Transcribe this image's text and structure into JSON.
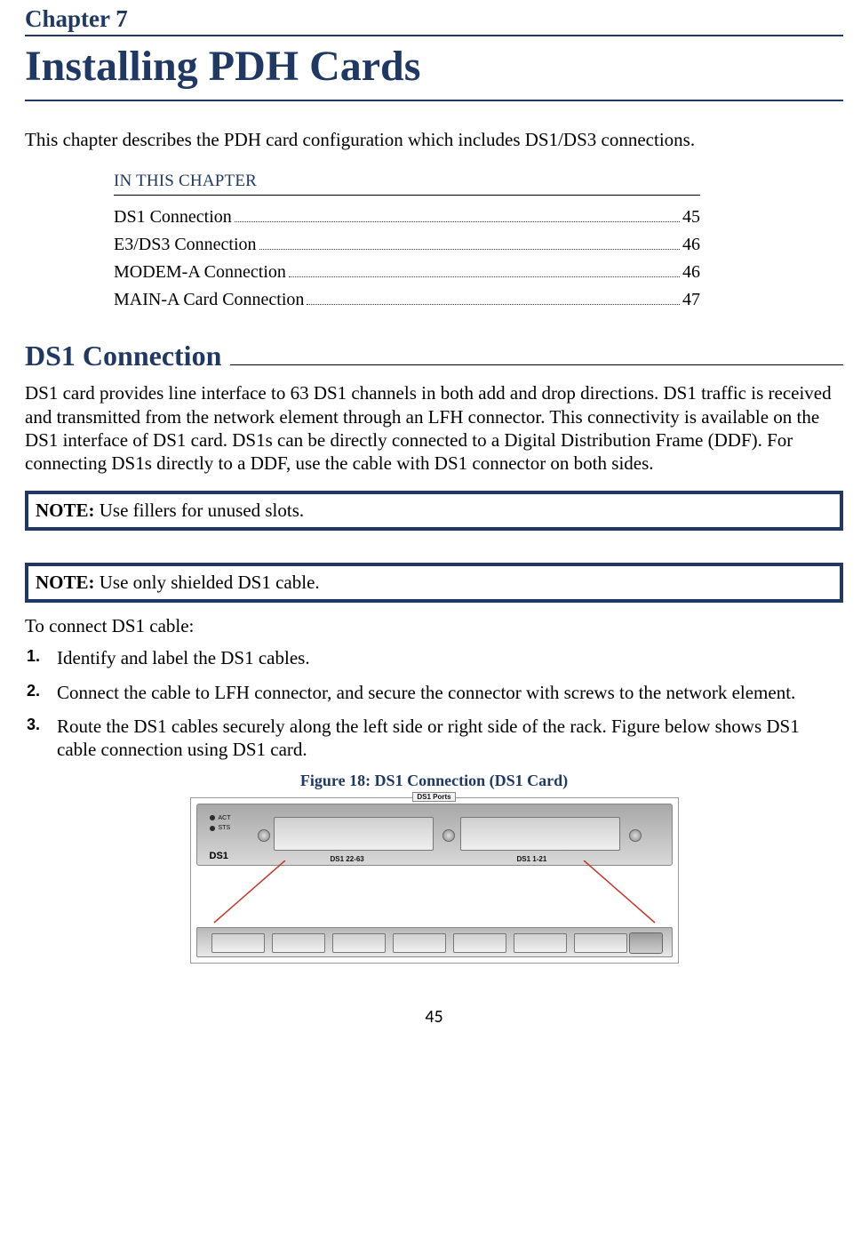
{
  "chapter": {
    "label": "Chapter 7",
    "title": "Installing PDH Cards"
  },
  "intro": "This chapter describes the PDH card configuration which includes DS1/DS3 connections.",
  "toc": {
    "heading": "IN THIS CHAPTER",
    "items": [
      {
        "label": "DS1 Connection",
        "page": "45"
      },
      {
        "label": "E3/DS3 Connection",
        "page": "46"
      },
      {
        "label": "MODEM-A Connection",
        "page": "46"
      },
      {
        "label": "MAIN-A Card Connection",
        "page": "47"
      }
    ]
  },
  "section": {
    "heading": "DS1 Connection",
    "body": "DS1 card provides line interface to 63 DS1 channels in both add and drop directions. DS1 traffic is received and transmitted from the network element through an LFH connector. This connectivity is available on the DS1 interface of DS1 card. DS1s can be directly connected to a Digital Distribution Frame (DDF). For connecting DS1s directly to a DDF, use the cable with DS1 connector on both sides."
  },
  "notes": {
    "prefix": "NOTE:",
    "n1": "Use fillers for unused slots.",
    "n2": "Use only shielded DS1 cable."
  },
  "procedure": {
    "leadin": "To connect DS1 cable:",
    "steps": [
      "Identify and label the DS1 cables.",
      "Connect the cable to LFH connector, and secure the connector with screws to the network element.",
      "Route the DS1 cables securely along the left side or right side of the rack. Figure below shows DS1 cable connection using DS1 card."
    ]
  },
  "figure": {
    "caption": "Figure 18: DS1 Connection (DS1 Card)",
    "labels": {
      "ports": "DS1 Ports",
      "card": "DS1",
      "act": "ACT",
      "sts": "STS",
      "port_range_a": "DS1 22-63",
      "port_range_b": "DS1 1-21"
    }
  },
  "page_number": "45"
}
